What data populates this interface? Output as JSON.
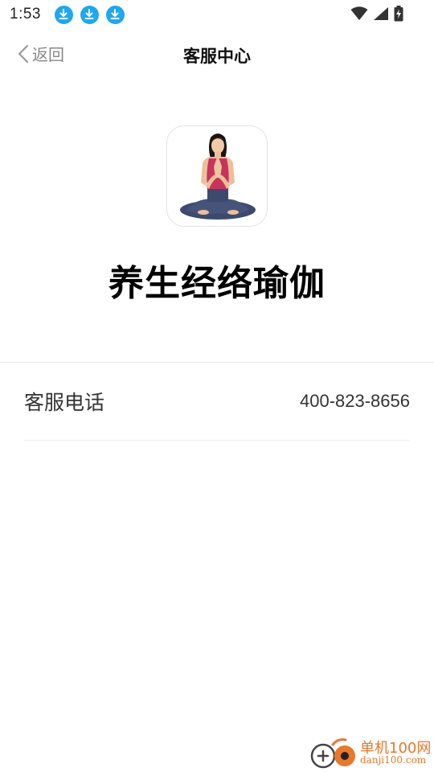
{
  "status_bar": {
    "time": "1:53",
    "notifications": [
      "download-icon",
      "download-icon",
      "download-icon"
    ],
    "right_icons": [
      "wifi-icon",
      "cell-signal-icon",
      "battery-charging-icon"
    ]
  },
  "nav": {
    "back_label": "返回",
    "title": "客服中心"
  },
  "app": {
    "name": "养生经络瑜伽",
    "icon": "yoga-woman-meditating-icon"
  },
  "contact": {
    "phone_label": "客服电话",
    "phone_value": "400-823-8656"
  },
  "watermark": {
    "cn": "单机100网",
    "en": "danji100.com"
  },
  "colors": {
    "accent_blue": "#1fa7ef",
    "watermark_orange": "#e8782c",
    "yoga_top": "#c8335a",
    "yoga_pants": "#3d4a6e"
  }
}
